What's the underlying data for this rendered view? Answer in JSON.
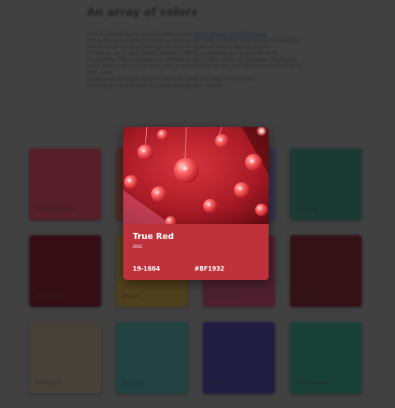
{
  "page": {
    "title": "An array of colors",
    "intro_prefix": "This is a demo application of response of ",
    "intro_link": "Demo Mocky color collection",
    "paragraphs": [
      "There shows 8 cards of Pantone colors in the grid arranged with space and use the colors of the cards either light or dark to contrast the background color.",
      "On hover, each card slowly rotates, shifting or moving any arranged cards.",
      "On clicking, the card opens a lightbox modal in the centre of the page, displaying more details about that color and a related photograph arranged with radiusable to that color.",
      "Clicking on the HEX value or pantone value will copy to clipboard.",
      "Clicking out of the card will close the lightbox modal."
    ]
  },
  "cards": [
    {
      "name": "Chrysanthemum",
      "color": "#62242f"
    },
    {
      "name": "",
      "color": "#5e3226"
    },
    {
      "name": "",
      "color": "#393d56"
    },
    {
      "name": "Turquoise",
      "color": "#1f433a"
    },
    {
      "name": "Chili Pepper",
      "color": "#3d1118"
    },
    {
      "name": "Mimosa",
      "color": "#5a4b22"
    },
    {
      "name": "Fuchsia Rose",
      "color": "#5a2437"
    },
    {
      "name": "True Red",
      "color": "#3c1419"
    },
    {
      "name": "Sand Dollar",
      "color": "#514b43"
    },
    {
      "name": "Aqua Sky",
      "color": "#264c4b"
    },
    {
      "name": "Blue Iris",
      "color": "#25224c"
    },
    {
      "name": "Blue Turquoise",
      "color": "#1d4a40"
    }
  ],
  "modal": {
    "name": "True Red",
    "year": "2002",
    "pantone_code": "19-1664",
    "hex": "#BF1932",
    "color": "#bf323c"
  }
}
